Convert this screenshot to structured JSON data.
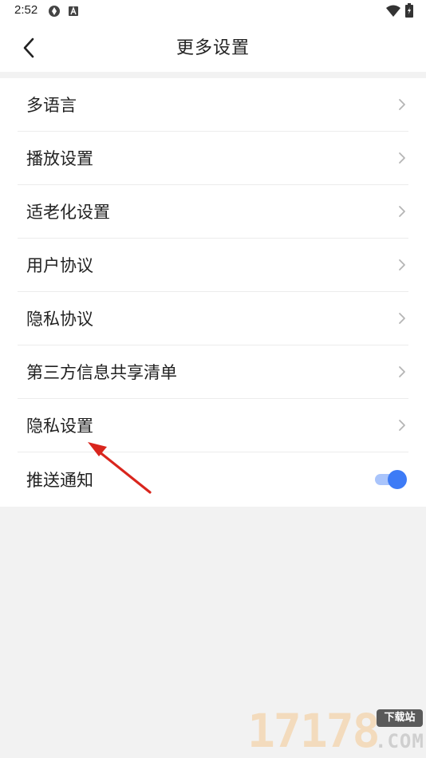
{
  "status_bar": {
    "time": "2:52"
  },
  "header": {
    "title": "更多设置",
    "back_icon": "chevron-left-icon"
  },
  "settings": {
    "items": [
      {
        "label": "多语言",
        "control": "chevron"
      },
      {
        "label": "播放设置",
        "control": "chevron"
      },
      {
        "label": "适老化设置",
        "control": "chevron"
      },
      {
        "label": "用户协议",
        "control": "chevron"
      },
      {
        "label": "隐私协议",
        "control": "chevron"
      },
      {
        "label": "第三方信息共享清单",
        "control": "chevron"
      },
      {
        "label": "隐私设置",
        "control": "chevron"
      },
      {
        "label": "推送通知",
        "control": "toggle",
        "toggle_on": true
      }
    ]
  },
  "colors": {
    "accent": "#3d7bf6",
    "toggle_track": "#a9c4fb",
    "annotation_arrow": "#d9251d",
    "page_background": "#f2f2f2"
  },
  "watermark": {
    "digits": "17178",
    "badge": "下载站",
    "suffix": ".COM"
  }
}
